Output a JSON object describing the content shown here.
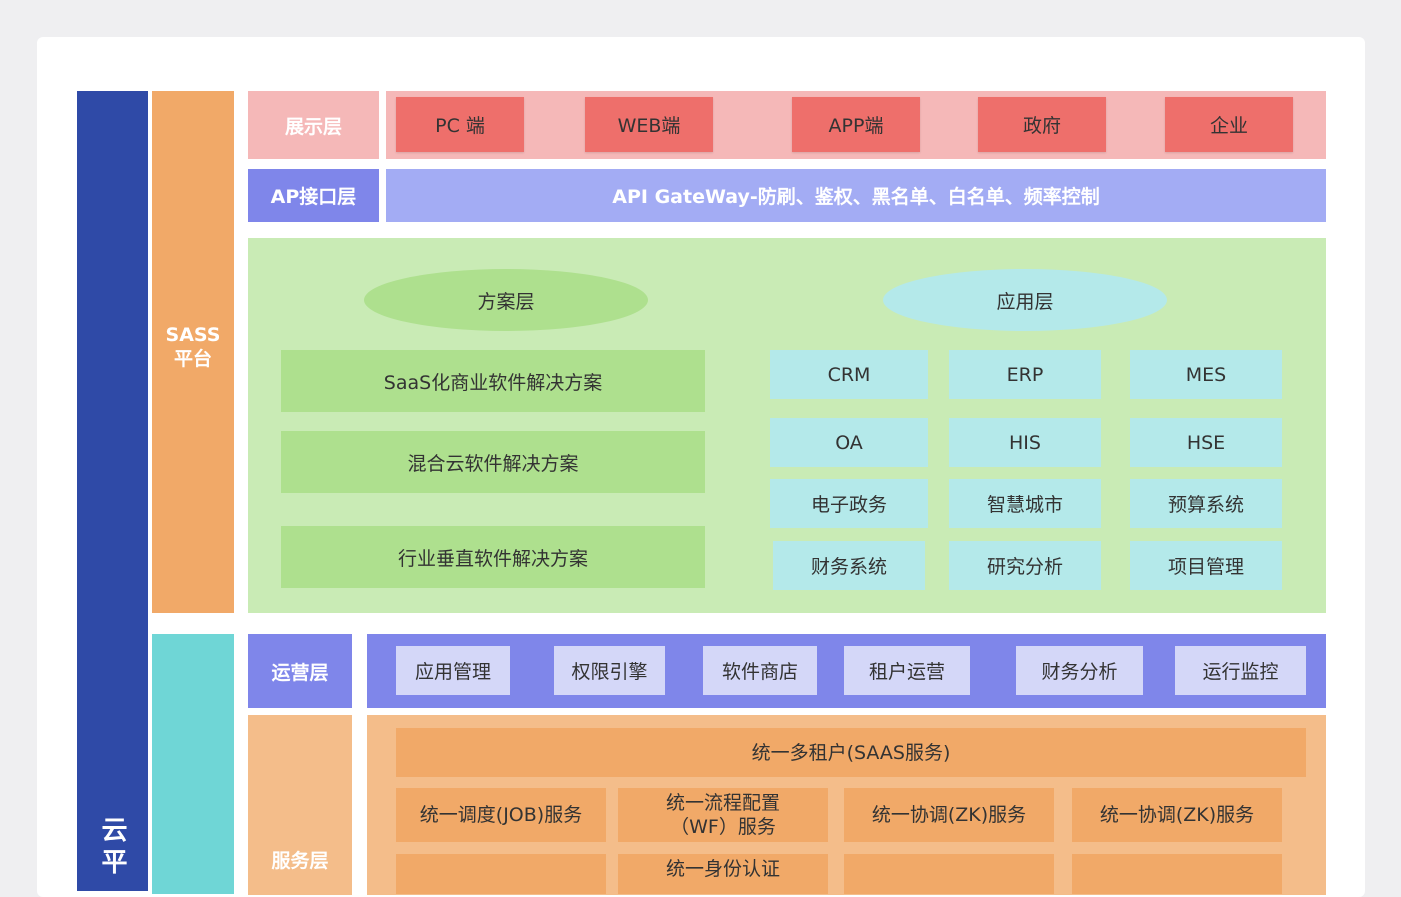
{
  "cloud_label": "云平",
  "saas_label": "SASS\n平台",
  "display_layer": {
    "label": "展示层",
    "items": [
      "PC 端",
      "WEB端",
      "APP端",
      "政府",
      "企业"
    ]
  },
  "api_layer": {
    "label": "AP接口层",
    "content": "API GateWay-防刷、鉴权、黑名单、白名单、频率控制"
  },
  "scheme_layer": {
    "title": "方案层",
    "items": [
      "SaaS化商业软件解决方案",
      "混合云软件解决方案",
      "行业垂直软件解决方案"
    ]
  },
  "app_layer": {
    "title": "应用层",
    "items": [
      "CRM",
      "ERP",
      "MES",
      "OA",
      "HIS",
      "HSE",
      "电子政务",
      "智慧城市",
      "预算系统",
      "财务系统",
      "研究分析",
      "项目管理"
    ]
  },
  "ops_layer": {
    "label": "运营层",
    "items": [
      "应用管理",
      "权限引擎",
      "软件商店",
      "租户运营",
      "财务分析",
      "运行监控"
    ]
  },
  "service_layer": {
    "label": "服务层",
    "header": "统一多租户(SAAS服务)",
    "items": [
      "统一调度(JOB)服务",
      "统一流程配置\n（WF）服务",
      "统一协调(ZK)服务",
      "统一协调(ZK)服务",
      "统一身份认证"
    ]
  },
  "colors": {
    "cloud_bar": "#2f4aa7",
    "saas_bar": "#f1a968",
    "display_red": "#ee6f6b",
    "api_purple": "#7f86ea",
    "green": "#aee08e",
    "cyan": "#b4e9ea",
    "service_orange": "#f1a968"
  }
}
